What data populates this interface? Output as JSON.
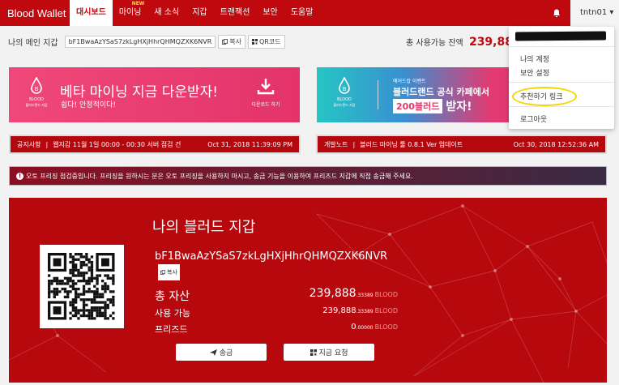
{
  "nav": {
    "brand": "Blood Wallet",
    "items": [
      {
        "label": "대시보드",
        "active": true
      },
      {
        "label": "마이닝",
        "badge": "NEW"
      },
      {
        "label": "새 소식"
      },
      {
        "label": "지갑"
      },
      {
        "label": "트랜잭션"
      },
      {
        "label": "보안"
      },
      {
        "label": "도움말"
      }
    ],
    "bell_icon": "bell-icon",
    "user": "tntn01 ▾"
  },
  "address_bar": {
    "title": "나의 메인 지갑",
    "address": "bF1BwaAzYSaS7zkLgHXjHhrQHMQZXK6NVR",
    "copy": "복사",
    "qr": "QR코드",
    "balance_label": "총 사용가능 잔액",
    "balance_value": "239,888."
  },
  "dropdown": {
    "items": [
      "나의 계정",
      "보안 설정",
      "추천하기 링크",
      "로그아웃"
    ],
    "highlight_color": "#f2d600"
  },
  "banner_a": {
    "logo": "BLOOD",
    "logo_sub": "블러드랜드 지갑",
    "title": "베타 마이닝 지금 다운받자!",
    "subtitle": "쉽다! 안정적이다!",
    "download": "다운로드 하기"
  },
  "banner_b": {
    "logo": "BLOOD",
    "logo_sub": "블러드랜드 지갑",
    "small": "에어드랍 이벤트",
    "title": "블러드랜드 공식 카페에서",
    "box": "200블러드",
    "bold": "받자!"
  },
  "notices": [
    {
      "cat": "공지사항",
      "text": "웹지갑 11월 1일 00:00 - 00:30 서버 점검 건",
      "date": "Oct 31, 2018 11:39:09 PM"
    },
    {
      "cat": "개발노트",
      "text": "블러드 마이닝 툴 0.8.1 Ver 업데이트",
      "date": "Oct 30, 2018 12:52:36 AM"
    }
  ],
  "warning": {
    "icon": "!",
    "text": "오토 프리징 점검중입니다. 프리징을 원하시는 분은 오토 프리징을 사용하지 마시고, 송금 기능을 이용하여 프리즈드 지갑에 직접 송금해 주세요."
  },
  "wallet": {
    "title": "나의 블러드 지갑",
    "address": "bF1BwaAzYSaS7zkLgHXjHhrQHMQZXK6NVR",
    "copy": "복사",
    "rows": [
      {
        "label": "총 자산",
        "int": "239,888",
        "dec": ".33389",
        "unit": "BLOOD"
      },
      {
        "label": "사용 가능",
        "int": "239,888",
        "dec": ".33389",
        "unit": "BLOOD"
      },
      {
        "label": "프리즈드",
        "int": "0",
        "dec": ".00000",
        "unit": "BLOOD"
      }
    ],
    "send": "송금",
    "request": "지금 요청"
  },
  "colors": {
    "brand": "#c0090f",
    "card": "#b7080e"
  }
}
